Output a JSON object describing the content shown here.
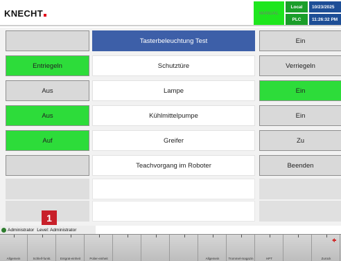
{
  "header": {
    "logo": "KNECHT",
    "mode": "MANUAL",
    "status_top": "Local",
    "status_bottom": "PLC",
    "date": "10/23/2025",
    "time": "11:26:32 PM"
  },
  "rows": [
    {
      "left": "",
      "left_color": "gray",
      "middle": "Tasterbeleuchtung Test",
      "right": "Ein",
      "right_color": "gray"
    },
    {
      "left": "Entriegeln",
      "left_color": "green",
      "middle": "Schutztüre",
      "right": "Verriegeln",
      "right_color": "gray"
    },
    {
      "left": "Aus",
      "left_color": "gray",
      "middle": "Lampe",
      "right": "Ein",
      "right_color": "green"
    },
    {
      "left": "Aus",
      "left_color": "green",
      "middle": "Kühlmittelpumpe",
      "right": "Ein",
      "right_color": "gray"
    },
    {
      "left": "Auf",
      "left_color": "green",
      "middle": "Greifer",
      "right": "Zu",
      "right_color": "gray"
    },
    {
      "left": "",
      "left_color": "gray",
      "middle": "Teachvorgang im Roboter",
      "right": "Beenden",
      "right_color": "gray"
    },
    {
      "left": "",
      "left_color": "empty",
      "middle": "",
      "right": "",
      "right_color": "empty"
    },
    {
      "left": "",
      "left_color": "empty",
      "middle": "",
      "right": "",
      "right_color": "empty"
    }
  ],
  "user": {
    "name": "Administrator",
    "level": "Level: Administrator"
  },
  "marker": "1",
  "function_keys": [
    {
      "label": "Allgemein"
    },
    {
      "label": "Schleif-funkt."
    },
    {
      "label": "Entgrat-einheit"
    },
    {
      "label": "Polier-einheit"
    },
    {
      "label": ""
    },
    {
      "label": ""
    },
    {
      "label": ""
    },
    {
      "label": "Allgemein"
    },
    {
      "label": "Trommel-magazin"
    },
    {
      "label": "HPT"
    },
    {
      "label": ""
    },
    {
      "label": "Zurück"
    }
  ],
  "colors": {
    "green": "#2ddc3a",
    "title_blue": "#3d5fa8",
    "plc_green": "#1a9e2a",
    "datetime_blue": "#1d4e96",
    "marker_red": "#c8202a"
  }
}
